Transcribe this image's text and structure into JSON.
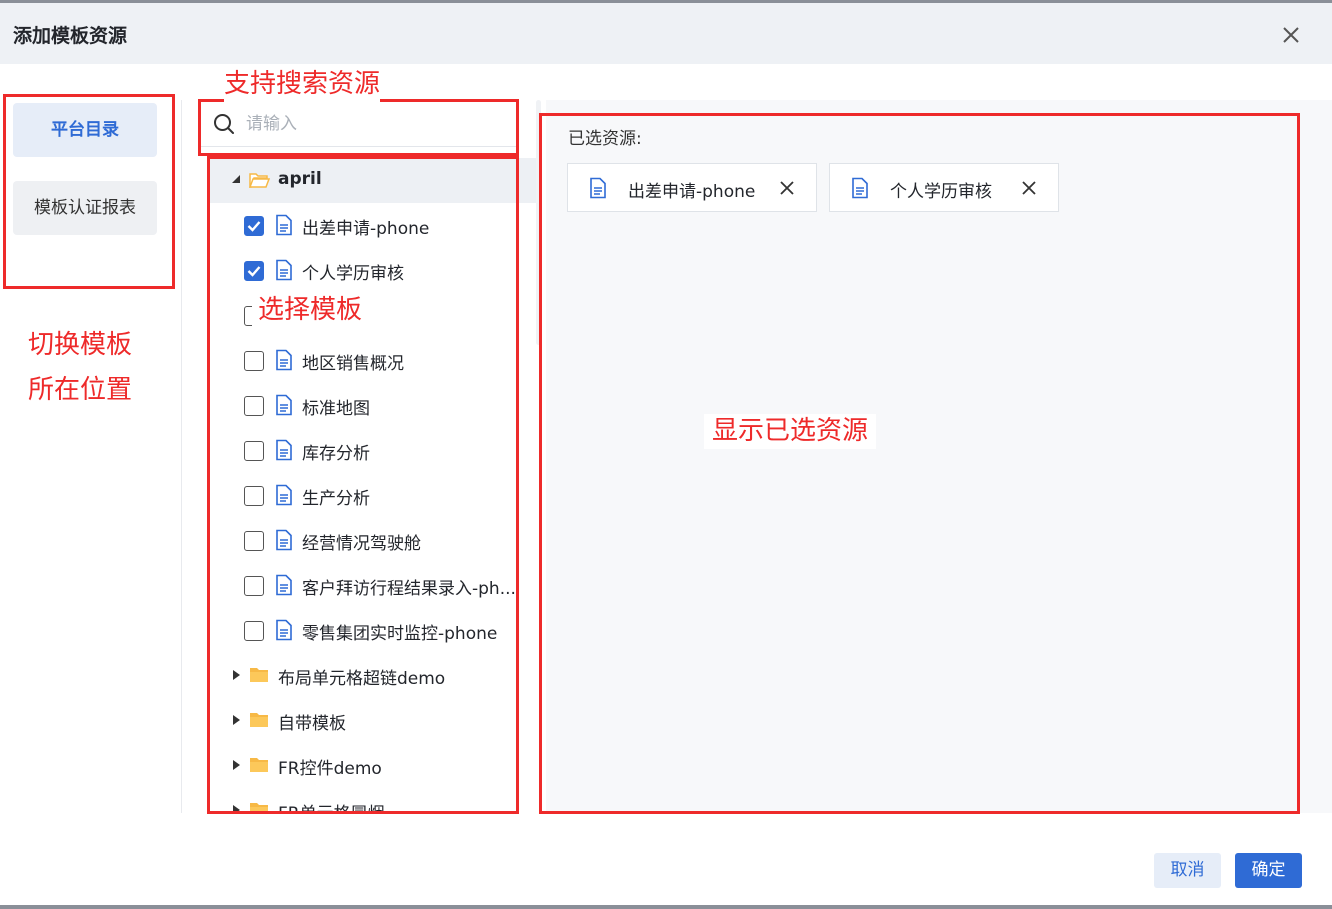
{
  "dialog": {
    "title": "添加模板资源"
  },
  "nav": {
    "items": [
      {
        "label": "平台目录",
        "active": true
      },
      {
        "label": "模板认证报表",
        "active": false
      }
    ]
  },
  "search": {
    "placeholder": "请输入",
    "value": ""
  },
  "tree": {
    "rows": [
      {
        "type": "folder",
        "label": "april",
        "expanded": true
      },
      {
        "type": "doc",
        "label": "出差申请-phone",
        "checked": true
      },
      {
        "type": "doc",
        "label": "个人学历审核",
        "checked": true
      },
      {
        "type": "doc",
        "label": "",
        "checked": false
      },
      {
        "type": "doc",
        "label": "地区销售概况",
        "checked": false
      },
      {
        "type": "doc",
        "label": "标准地图",
        "checked": false
      },
      {
        "type": "doc",
        "label": "库存分析",
        "checked": false
      },
      {
        "type": "doc",
        "label": "生产分析",
        "checked": false
      },
      {
        "type": "doc",
        "label": "经营情况驾驶舱",
        "checked": false
      },
      {
        "type": "doc",
        "label": "客户拜访行程结果录入-ph...",
        "checked": false
      },
      {
        "type": "doc",
        "label": "零售集团实时监控-phone",
        "checked": false
      },
      {
        "type": "folder",
        "label": "布局单元格超链demo",
        "expanded": false
      },
      {
        "type": "folder",
        "label": "自带模板",
        "expanded": false
      },
      {
        "type": "folder",
        "label": "FR控件demo",
        "expanded": false
      },
      {
        "type": "folder",
        "label": "FR单元格冒烟",
        "expanded": false
      }
    ]
  },
  "selected": {
    "title": "已选资源:",
    "items": [
      {
        "label": "出差申请-phone"
      },
      {
        "label": "个人学历审核"
      }
    ]
  },
  "annotations": {
    "search": "支持搜索资源",
    "select": "选择模板",
    "switch_line1": "切换模板",
    "switch_line2": "所在位置",
    "show_selected": "显示已选资源"
  },
  "footer": {
    "cancel_label": "取消",
    "ok_label": "确定"
  },
  "colors": {
    "accent": "#2f6bd5",
    "annotation": "#ee2a2a",
    "folder": "#f7b946"
  }
}
